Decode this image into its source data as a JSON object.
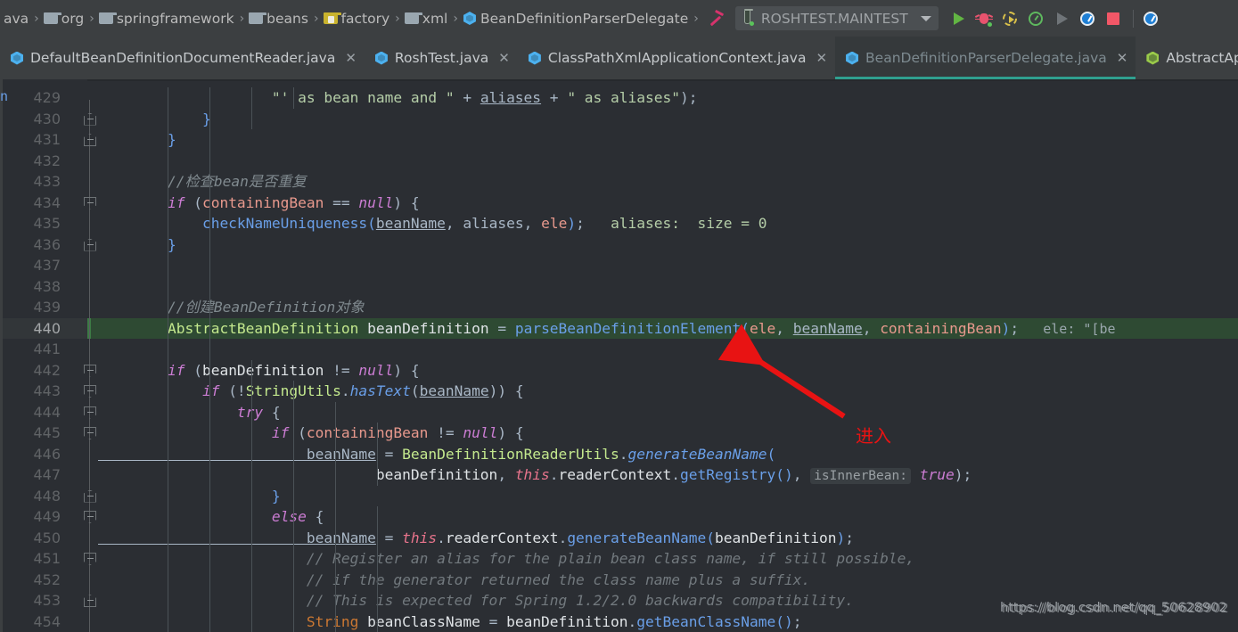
{
  "breadcrumb": {
    "items": [
      {
        "label": "ava",
        "icon": "none"
      },
      {
        "label": "org",
        "icon": "folder-icon"
      },
      {
        "label": "springframework",
        "icon": "folder-icon"
      },
      {
        "label": "beans",
        "icon": "folder-icon"
      },
      {
        "label": "factory",
        "icon": "folder-resource-icon"
      },
      {
        "label": "xml",
        "icon": "folder-icon"
      },
      {
        "label": "BeanDefinitionParserDelegate",
        "icon": "java-class-icon"
      }
    ],
    "separator": "›"
  },
  "toolbar": {
    "build_icon": "hammer-icon",
    "run_config": {
      "icon": "test-tube-icon",
      "label": "ROSHTEST.MAINTEST",
      "dropdown_icon": "chevron-down-icon"
    },
    "actions": [
      {
        "name": "run-button",
        "icon": "run-triangle-icon"
      },
      {
        "name": "debug-button",
        "icon": "debug-bug-icon"
      },
      {
        "name": "run-with-coverage-button",
        "icon": "coverage-circle-icon"
      },
      {
        "name": "profile-button",
        "icon": "profiler-gauge-icon"
      },
      {
        "name": "run-grey-button",
        "icon": "run-triangle-grey-icon"
      },
      {
        "name": "attach-profiler-button",
        "icon": "blue-profiler-icon"
      },
      {
        "name": "stop-button",
        "icon": "stop-square-icon"
      },
      {
        "name": "more-button",
        "icon": "blue-profiler-icon"
      }
    ]
  },
  "tabs": [
    {
      "label": "DefaultBeanDefinitionDocumentReader.java",
      "icon": "java-class-icon",
      "close": "✕",
      "active": false
    },
    {
      "label": "RoshTest.java",
      "icon": "java-class-icon",
      "close": "✕",
      "active": false
    },
    {
      "label": "ClassPathXmlApplicationContext.java",
      "icon": "java-class-icon",
      "close": "✕",
      "active": false
    },
    {
      "label": "BeanDefinitionParserDelegate.java",
      "icon": "java-class-icon",
      "close": "✕",
      "active": true
    },
    {
      "label": "AbstractApplicationCo",
      "icon": "abstract-class-icon",
      "close": "",
      "active": false
    }
  ],
  "editor": {
    "first_line": 429,
    "highlighted_line": 440,
    "lines": [
      429,
      430,
      431,
      432,
      433,
      434,
      435,
      436,
      437,
      438,
      439,
      440,
      441,
      442,
      443,
      444,
      445,
      446,
      447,
      448,
      449,
      450,
      451,
      452,
      453,
      454
    ],
    "code_lines": [
      {
        "n": 429,
        "html": "<span class=\"str\">                    \"' as bean name and \"</span><span class=\"pnct\"> + </span><span class=\"fld\">aliases</span><span class=\"pnct\"> + </span><span class=\"str\">\" as aliases\"</span><span class=\"pnct\">);</span>"
      },
      {
        "n": 430,
        "html": "<span class=\"blue-p\">            }</span>"
      },
      {
        "n": 431,
        "html": "<span class=\"blue-p\">        }</span>"
      },
      {
        "n": 432,
        "html": ""
      },
      {
        "n": 433,
        "html": "<span class=\"cmtc\">        //检查bean是否重复</span>"
      },
      {
        "n": 434,
        "html": "<span class=\"kw\">        if </span><span class=\"pnct\">(</span><span class=\"var\">containingBean</span><span class=\"pnct\"> == </span><span class=\"kw\">null</span><span class=\"pnct\">) {</span>"
      },
      {
        "n": 435,
        "html": "<span class=\"fn\">            checkNameUniqueness</span><span class=\"blue-p\">(</span><span class=\"fld\">beanName</span><span class=\"pnct\">, </span><span class=\"fld2\">aliases</span><span class=\"pnct\">, </span><span class=\"var\">ele</span><span class=\"blue-p\">)</span><span class=\"pnct\">;</span>"
      },
      {
        "n": 436,
        "html": "<span class=\"blue-p\">        }</span>"
      },
      {
        "n": 437,
        "html": ""
      },
      {
        "n": 438,
        "html": ""
      },
      {
        "n": 439,
        "html": "<span class=\"cmtc\">        //创建BeanDefinition对象</span>"
      },
      {
        "n": 440,
        "html": "<span class=\"typ\">        AbstractBeanDefinition </span><span class=\"white\">beanDefinition</span><span class=\"pnct\"> = </span><span class=\"fn\">parseBeanDefinitionElement</span><span class=\"blue-p\">(</span><span class=\"var\">ele</span><span class=\"pnct\">, </span><span class=\"fld\">beanName</span><span class=\"pnct\">, </span><span class=\"var\">containingBean</span><span class=\"blue-p\">)</span><span class=\"pnct\">;</span>"
      },
      {
        "n": 441,
        "html": ""
      },
      {
        "n": 442,
        "html": "<span class=\"kw\">        if </span><span class=\"pnct\">(</span><span class=\"white\">beanDefinition</span><span class=\"pnct\"> != </span><span class=\"kw\">null</span><span class=\"pnct\">) {</span>"
      },
      {
        "n": 443,
        "html": "<span class=\"kw\">            if </span><span class=\"pnct\">(!</span><span class=\"typ\">StringUtils</span><span class=\"pnct\">.</span><span class=\"fni\">hasText</span><span class=\"pnct\">(</span><span class=\"fld\">beanName</span><span class=\"pnct\">)) {</span>"
      },
      {
        "n": 444,
        "html": "<span class=\"kw\">                try </span><span class=\"pnct\">{</span>"
      },
      {
        "n": 445,
        "html": "<span class=\"kw\">                    if </span><span class=\"pnct\">(</span><span class=\"var\">containingBean</span><span class=\"pnct\"> != </span><span class=\"kw\">null</span><span class=\"pnct\">) {</span>"
      },
      {
        "n": 446,
        "html": "<span class=\"fld\">                        beanName</span><span class=\"pnct\"> = </span><span class=\"typ\">BeanDefinitionReaderUtils</span><span class=\"pnct\">.</span><span class=\"fni\">generateBeanName</span><span class=\"blue-p\">(</span>"
      },
      {
        "n": 447,
        "html": "<span class=\"white\">                                beanDefinition</span><span class=\"pnct\">, </span><span class=\"kwth\">this</span><span class=\"pnct\">.</span><span class=\"white\">readerContext</span><span class=\"pnct\">.</span><span class=\"fn\">getRegistry</span><span class=\"blue-p\">()</span><span class=\"pnct\">, </span>"
      },
      {
        "n": 448,
        "html": "<span class=\"blue-p\">                    }</span>"
      },
      {
        "n": 449,
        "html": "<span class=\"kw\">                    else </span><span class=\"pnct\">{</span>"
      },
      {
        "n": 450,
        "html": "<span class=\"fld\">                        beanName</span><span class=\"pnct\"> = </span><span class=\"kwth\">this</span><span class=\"pnct\">.</span><span class=\"white\">readerContext</span><span class=\"pnct\">.</span><span class=\"fn\">generateBeanName</span><span class=\"blue-p\">(</span><span class=\"white\">beanDefinition</span><span class=\"blue-p\">)</span><span class=\"pnct\">;</span>"
      },
      {
        "n": 451,
        "html": "<span class=\"cmt\">                        // Register an alias for the plain bean class name, if still possible,</span>"
      },
      {
        "n": 452,
        "html": "<span class=\"cmt\">                        // if the generator returned the class name plus a suffix.</span>"
      },
      {
        "n": 453,
        "html": "<span class=\"cmt\">                        // This is expected for Spring 1.2/2.0 backwards compatibility.</span>"
      },
      {
        "n": 454,
        "html": "<span class=\"kw2\">                        String </span><span class=\"white\">beanClassName</span><span class=\"pnct\"> = </span><span class=\"white\">beanDefinition</span><span class=\"pnct\">.</span><span class=\"fn\">getBeanClassName</span><span class=\"blue-p\">()</span><span class=\"pnct\">;</span>"
      }
    ],
    "inline_hints": [
      {
        "line": 435,
        "text": "aliases:  size = 0"
      },
      {
        "line": 440,
        "text": "ele: \"[be"
      }
    ],
    "param_hints": [
      {
        "line": 447,
        "text": "isInnerBean:",
        "value": "true",
        "suffix": ");"
      }
    ]
  },
  "annotation": {
    "arrow": "red-arrow-icon",
    "text": "进入"
  },
  "watermark": {
    "text": "https://blog.csdn.net/qq_50628902"
  },
  "colors": {
    "background": "#2b2e33",
    "chrome": "#3c3f41",
    "active_tab": "#35393b",
    "active_tab_underline": "#2fa08f",
    "highlight_line": "#2e4a33",
    "annotation_red": "#e81313",
    "accent_blue": "#4cb1ef",
    "run_green": "#62b543",
    "stop_red": "#f25767"
  }
}
